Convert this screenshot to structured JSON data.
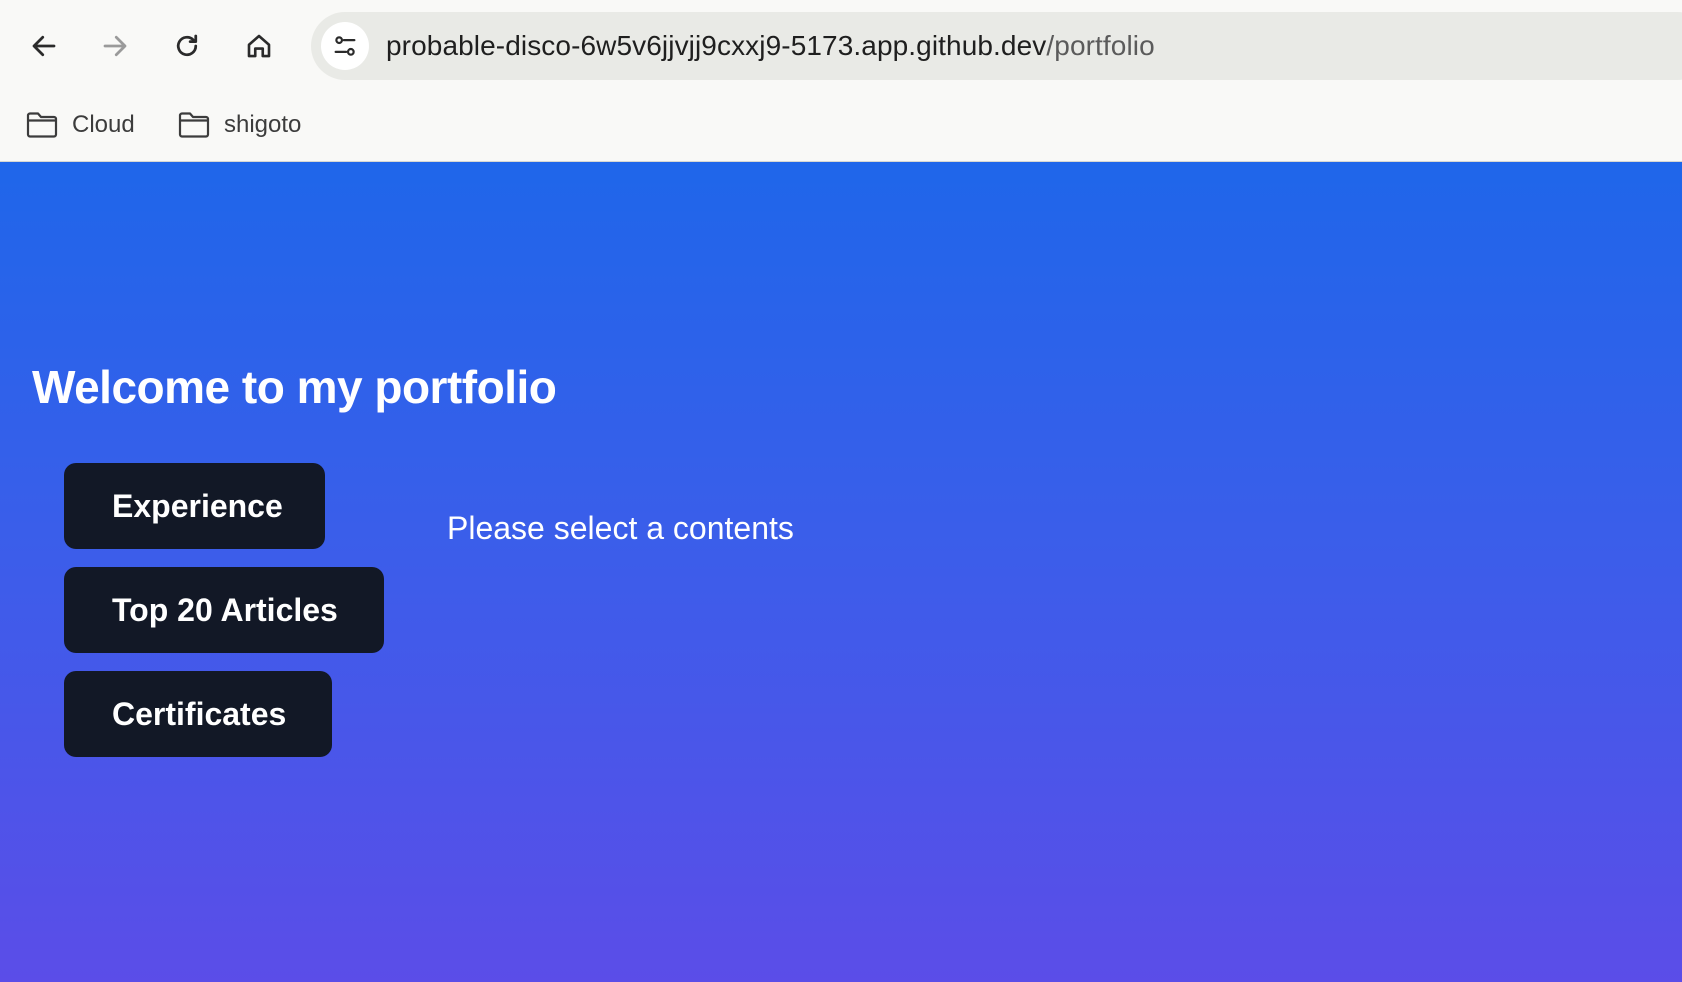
{
  "browser": {
    "url_host": "probable-disco-6w5v6jjvjj9cxxj9-5173.app.github.dev",
    "url_path": "/portfolio",
    "bookmarks": [
      {
        "label": "Cloud",
        "icon": "folder-icon"
      },
      {
        "label": "shigoto",
        "icon": "folder-icon"
      }
    ]
  },
  "page": {
    "title": "Welcome to my portfolio",
    "menu": [
      {
        "label": "Experience"
      },
      {
        "label": "Top 20 Articles"
      },
      {
        "label": "Certificates"
      }
    ],
    "placeholder": "Please select a contents"
  },
  "colors": {
    "gradient_top": "#1f66ea",
    "gradient_bottom": "#5b4de8",
    "button_bg": "#121826",
    "text_on_page": "#ffffff"
  }
}
